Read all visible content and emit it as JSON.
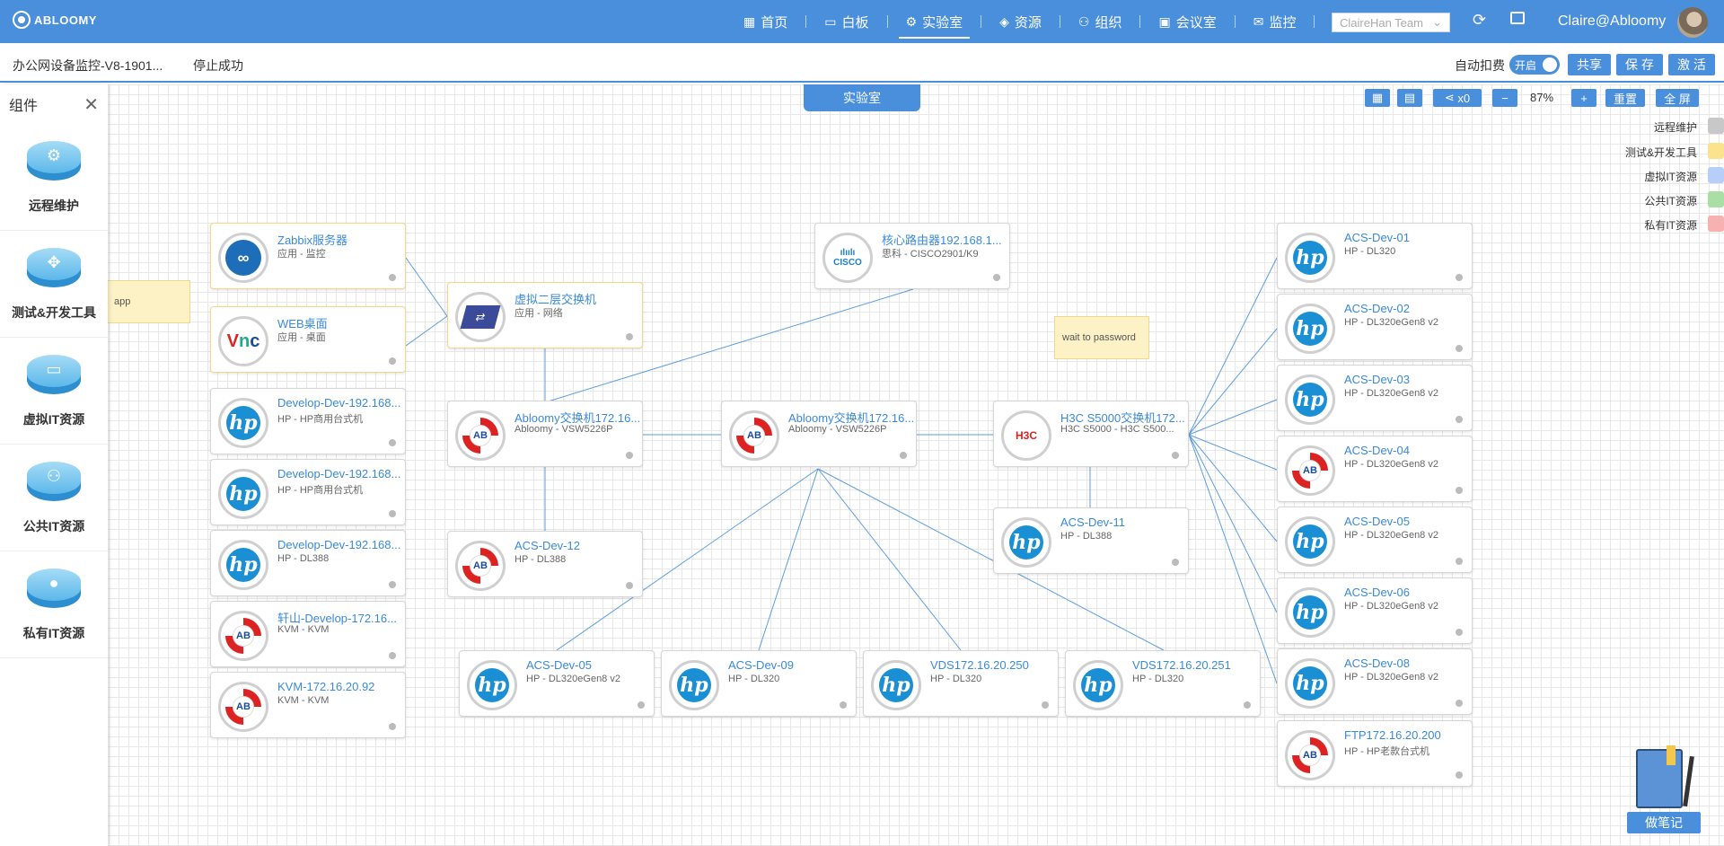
{
  "brand": {
    "logo_text": "ABLOOMY"
  },
  "nav": [
    {
      "label": "首页",
      "icon": "grid-icon"
    },
    {
      "label": "白板",
      "icon": "monitor-icon"
    },
    {
      "label": "实验室",
      "icon": "gear-icon",
      "active": true
    },
    {
      "label": "资源",
      "icon": "layers-icon"
    },
    {
      "label": "组织",
      "icon": "org-icon"
    },
    {
      "label": "会议室",
      "icon": "image-icon"
    },
    {
      "label": "监控",
      "icon": "mail-icon"
    }
  ],
  "team_select": {
    "value": "ClaireHan Team"
  },
  "user": {
    "name": "Claire@Abloomy"
  },
  "subbar": {
    "lab_name": "办公网设备监控-V8-1901...",
    "status": "停止成功",
    "auto_label": "自动扣费",
    "toggle_label": "开启",
    "share": "共享",
    "save": "保 存",
    "activate": "激 活"
  },
  "lab_tab": "实验室",
  "toolbar": {
    "share_count": "x0",
    "zoom": "87%",
    "reset": "重置",
    "fullscreen": "全 屏"
  },
  "legend": [
    {
      "label": "远程维护",
      "color": "#c8c8c8"
    },
    {
      "label": "测试&开发工具",
      "color": "#fbe38e"
    },
    {
      "label": "虚拟IT资源",
      "color": "#b7cff8"
    },
    {
      "label": "公共IT资源",
      "color": "#a9dfa5"
    },
    {
      "label": "私有IT资源",
      "color": "#f8b1b1"
    }
  ],
  "sidebar": {
    "title": "组件",
    "items": [
      {
        "label": "远程维护"
      },
      {
        "label": "测试&开发工具"
      },
      {
        "label": "虚拟IT资源"
      },
      {
        "label": "公共IT资源"
      },
      {
        "label": "私有IT资源"
      }
    ]
  },
  "nodes": [
    {
      "title": "Zabbix服务器",
      "sub": "应用 - 监控"
    },
    {
      "title": "WEB桌面",
      "sub": "应用 - 桌面"
    },
    {
      "title": "Develop-Dev-192.168...",
      "sub": "HP - HP商用台式机"
    },
    {
      "title": "Develop-Dev-192.168...",
      "sub": "HP - HP商用台式机"
    },
    {
      "title": "Develop-Dev-192.168...",
      "sub": "HP - DL388"
    },
    {
      "title": "轩山-Develop-172.16...",
      "sub": "KVM - KVM"
    },
    {
      "title": "KVM-172.16.20.92",
      "sub": "KVM - KVM"
    },
    {
      "title": "虚拟二层交换机",
      "sub": "应用 - 网络"
    },
    {
      "title": "Abloomy交换机172.16...",
      "sub": "Abloomy - VSW5226P"
    },
    {
      "title": "ACS-Dev-12",
      "sub": "HP - DL388"
    },
    {
      "title": "核心路由器192.168.1...",
      "sub": "思科 - CISCO2901/K9"
    },
    {
      "title": "Abloomy交换机172.16...",
      "sub": "Abloomy - VSW5226P"
    },
    {
      "title": "H3C S5000交换机172....",
      "sub": "H3C S5000 - H3C S500..."
    },
    {
      "title": "ACS-Dev-11",
      "sub": "HP - DL388"
    },
    {
      "title": "ACS-Dev-05",
      "sub": "HP - DL320eGen8 v2"
    },
    {
      "title": "ACS-Dev-09",
      "sub": "HP - DL320"
    },
    {
      "title": "VDS172.16.20.250",
      "sub": "HP - DL320"
    },
    {
      "title": "VDS172.16.20.251",
      "sub": "HP - DL320"
    },
    {
      "title": "ACS-Dev-01",
      "sub": "HP - DL320"
    },
    {
      "title": "ACS-Dev-02",
      "sub": "HP - DL320eGen8 v2"
    },
    {
      "title": "ACS-Dev-03",
      "sub": "HP - DL320eGen8 v2"
    },
    {
      "title": "ACS-Dev-04",
      "sub": "HP - DL320eGen8 v2"
    },
    {
      "title": "ACS-Dev-05",
      "sub": "HP - DL320eGen8 v2"
    },
    {
      "title": "ACS-Dev-06",
      "sub": "HP - DL320eGen8 v2"
    },
    {
      "title": "ACS-Dev-08",
      "sub": "HP - DL320eGen8 v2"
    },
    {
      "title": "FTP172.16.20.200",
      "sub": "HP - HP老款台式机"
    }
  ],
  "notes": [
    {
      "text": "app"
    },
    {
      "text": "wait to password"
    }
  ],
  "notebook": {
    "button": "做笔记"
  }
}
